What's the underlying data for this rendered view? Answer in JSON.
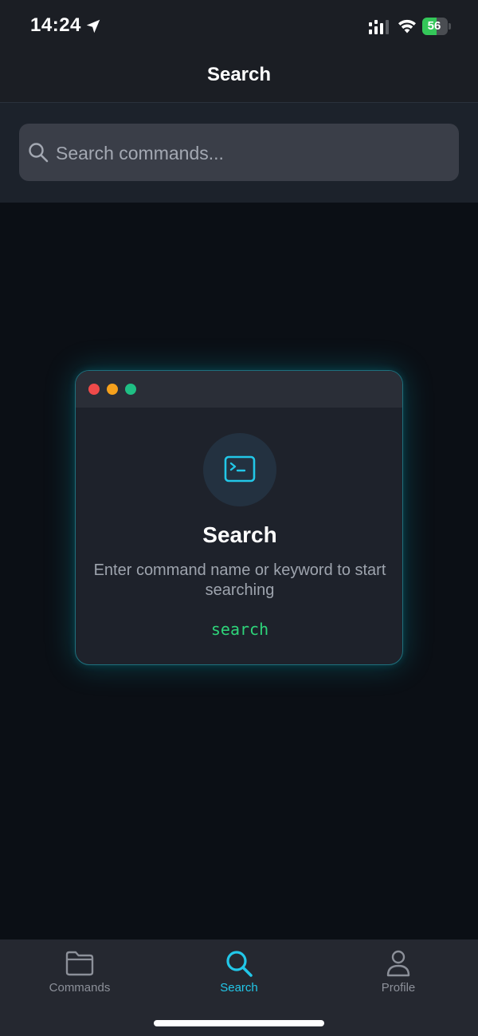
{
  "status_bar": {
    "time": "14:24",
    "battery": "56",
    "battery_level": 0.56,
    "icons": [
      "location-arrow-icon",
      "signal-icon",
      "wifi-icon",
      "battery-icon"
    ]
  },
  "header": {
    "title": "Search"
  },
  "search": {
    "placeholder": "Search commands...",
    "value": ""
  },
  "empty_state": {
    "title": "Search",
    "description": "Enter command name or keyword to start searching",
    "code": "search",
    "icon": "terminal-icon"
  },
  "tabs": [
    {
      "label": "Commands",
      "icon": "folder-icon",
      "active": false
    },
    {
      "label": "Search",
      "icon": "search-icon",
      "active": true
    },
    {
      "label": "Profile",
      "icon": "person-icon",
      "active": false
    }
  ],
  "colors": {
    "accent": "#22c7e8",
    "code_green": "#2ed47a",
    "background": "#0b0f15",
    "battery_green": "#34c759"
  }
}
